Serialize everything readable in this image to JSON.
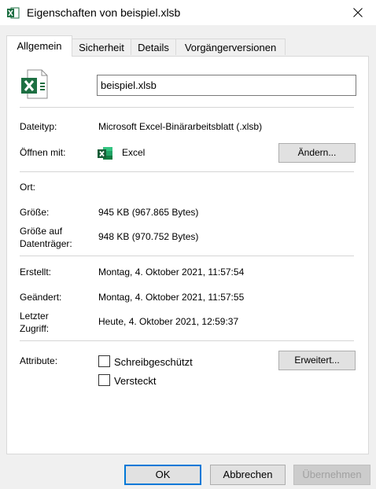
{
  "window": {
    "title": "Eigenschaften von beispiel.xlsb",
    "title_icon": "excel-file-icon",
    "close_icon": "close-icon"
  },
  "tabs": [
    {
      "label": "Allgemein",
      "active": true
    },
    {
      "label": "Sicherheit",
      "active": false
    },
    {
      "label": "Details",
      "active": false
    },
    {
      "label": "Vorgängerversionen",
      "active": false
    }
  ],
  "file": {
    "name": "beispiel.xlsb",
    "icon": "excel-file-icon"
  },
  "properties": {
    "type_label": "Dateityp:",
    "type_value": "Microsoft Excel-Binärarbeitsblatt (.xlsb)",
    "opens_with_label": "Öffnen mit:",
    "opens_with_value": "Excel",
    "opens_with_icon": "excel-app-icon",
    "change_button": "Ändern...",
    "location_label": "Ort:",
    "location_value": "",
    "size_label": "Größe:",
    "size_value": "945 KB (967.865 Bytes)",
    "size_on_disk_label_1": "Größe auf",
    "size_on_disk_label_2": "Datenträger:",
    "size_on_disk_value": "948 KB (970.752 Bytes)",
    "created_label": "Erstellt:",
    "created_value": "Montag, 4. Oktober 2021, 11:57:54",
    "modified_label": "Geändert:",
    "modified_value": "Montag, 4. Oktober 2021, 11:57:55",
    "accessed_label_1": "Letzter",
    "accessed_label_2": "Zugriff:",
    "accessed_value": "Heute, 4. Oktober 2021, 12:59:37",
    "attributes_label": "Attribute:",
    "readonly_label": "Schreibgeschützt",
    "readonly_checked": false,
    "hidden_label": "Versteckt",
    "hidden_checked": false,
    "advanced_button": "Erweitert..."
  },
  "footer": {
    "ok": "OK",
    "cancel": "Abbrechen",
    "apply": "Übernehmen"
  },
  "colors": {
    "excel_green": "#1d6f42",
    "accent_blue": "#0078d7"
  }
}
